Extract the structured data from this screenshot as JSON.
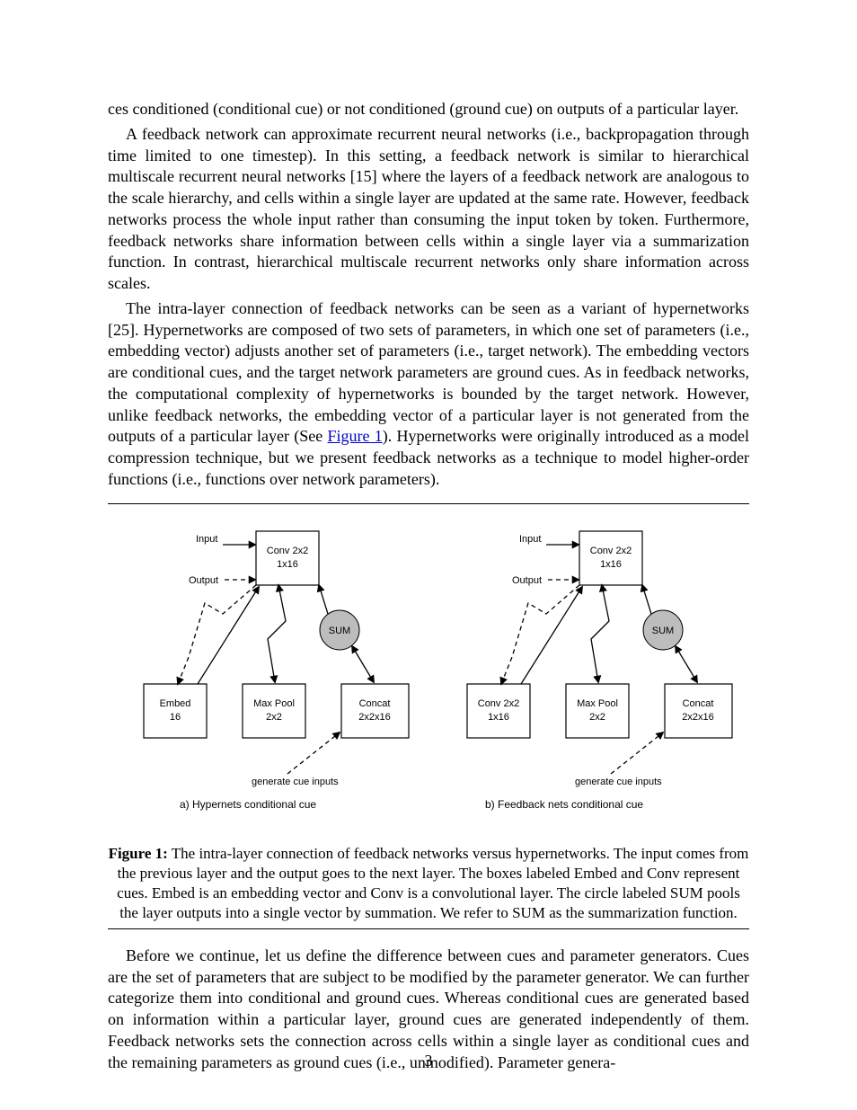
{
  "paragraphs": {
    "intro1": "ces conditioned (conditional cue) or not conditioned (ground cue) on outputs of a particular layer.",
    "intro2": "A feedback network can approximate recurrent neural networks (i.e., backpropagation through time limited to one timestep). In this setting, a feedback network is similar to hierarchical multiscale recurrent neural networks [15] where the layers of a feedback network are analogous to the scale hierarchy, and cells within a single layer are updated at the same rate. However, feedback networks process the whole input rather than consuming the input token by token. Furthermore, feedback networks share information between cells within a single layer via a summarization function. In contrast, hierarchical multiscale recurrent networks only share information across scales.",
    "intro3": "The intra-layer connection of feedback networks can be seen as a variant of hypernetworks [25]. Hypernetworks are composed of two sets of parameters, in which one set of parameters (i.e., embedding vector) adjusts another set of parameters (i.e., target network). The embedding vectors are conditional cues, and the target network parameters are ground cues. As in feedback networks, the computational complexity of hypernetworks is bounded by the target network. However, unlike feedback networks, the embedding vector of a particular layer is not generated from the outputs of a particular layer. Hypernetworks were originally introduced as a model compression technique, but we present feedback networks as a technique to model higher-order functions (i.e., functions over network parameters)."
  },
  "figure": {
    "ref_label": "Figure 1",
    "panel_a_label": "a) Hypernets conditional cue",
    "panel_b_label": "b) Feedback nets conditional cue",
    "sum_label": "SUM",
    "input_label": "Input",
    "output_label": "Output",
    "boxes": {
      "conv": "Conv 2x2\\n1x16",
      "embed": "Embed\\n16",
      "maxpool": "Max Pool\\n2x2",
      "concat": "Concat\\n2x2x16"
    },
    "gencue_inputs": "generate cue inputs",
    "caption_bold": "Figure 1:",
    "caption_text": " The intra-layer connection of feedback networks versus hypernetworks. The input comes from the previous layer and the output goes to the next layer. The boxes labeled Embed and Conv represent cues. Embed is an embedding vector and Conv is a convolutional layer. The circle labeled SUM pools the layer outputs into a single vector by summation. We refer to SUM as the summarization function."
  },
  "after": {
    "p1_indented": "Before we continue, let us define the difference between cues and parameter generators. Cues are the set of parameters that are subject to be modified by the parameter generator. We can further categorize them into conditional and ground cues. Whereas conditional cues are generated based on information within a particular layer, ground cues are generated independently of them. Feedback networks sets the connection across cells within a single layer as conditional cues and the remaining parameters as ground cues (i.e., unmodified). Parameter genera-"
  },
  "page_number": "3"
}
